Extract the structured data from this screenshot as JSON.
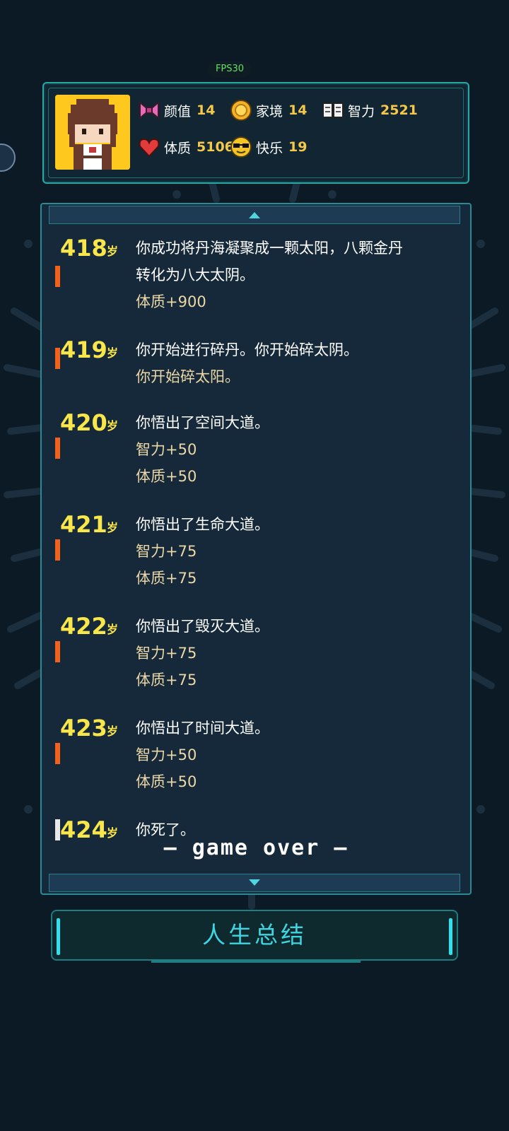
{
  "fps": "FPS30",
  "stats": {
    "row1": [
      {
        "icon": "bow-icon",
        "label": "颜值",
        "value": "14"
      },
      {
        "icon": "coin-icon",
        "label": "家境",
        "value": "14"
      },
      {
        "icon": "book-icon",
        "label": "智力",
        "value": "2521"
      }
    ],
    "row2": [
      {
        "icon": "heart-icon",
        "label": "体质",
        "value": "5106"
      },
      {
        "icon": "sunglasses-icon",
        "label": "快乐",
        "value": "19"
      }
    ]
  },
  "age_unit": "岁",
  "entries": [
    {
      "age": "418",
      "lines": [
        "你成功将丹海凝聚成一颗太阳，八颗金丹",
        "转化为八大太阴。"
      ],
      "effects": [
        "体质+900"
      ]
    },
    {
      "age": "419",
      "lines": [
        "你开始进行碎丹。你开始碎太阴。"
      ],
      "effects": [
        "你开始碎太阳。"
      ]
    },
    {
      "age": "420",
      "lines": [
        "你悟出了空间大道。"
      ],
      "effects": [
        "智力+50",
        "体质+50"
      ]
    },
    {
      "age": "421",
      "lines": [
        "你悟出了生命大道。"
      ],
      "effects": [
        "智力+75",
        "体质+75"
      ]
    },
    {
      "age": "422",
      "lines": [
        "你悟出了毁灭大道。"
      ],
      "effects": [
        "智力+75",
        "体质+75"
      ]
    },
    {
      "age": "423",
      "lines": [
        "你悟出了时间大道。"
      ],
      "effects": [
        "智力+50",
        "体质+50"
      ]
    },
    {
      "age": "424",
      "lines": [
        "你死了。"
      ],
      "effects": []
    }
  ],
  "game_over": "— game over —",
  "summary_button": "人生总结",
  "colors": {
    "accent": "#3ed5e0",
    "age": "#f8e64a",
    "marker": "#f2621b",
    "effect": "#ecd8a6"
  }
}
